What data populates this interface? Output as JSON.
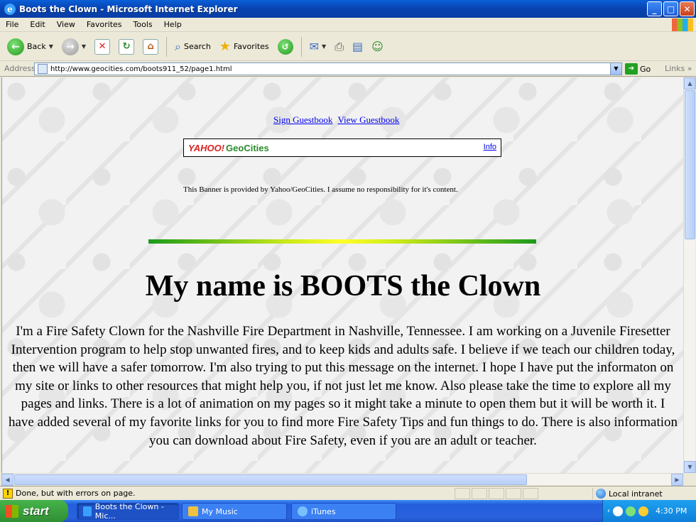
{
  "window": {
    "title": "Boots the Clown - Microsoft Internet Explorer"
  },
  "menu": [
    "File",
    "Edit",
    "View",
    "Favorites",
    "Tools",
    "Help"
  ],
  "toolbar": {
    "back_label": "Back",
    "search_label": "Search",
    "favorites_label": "Favorites"
  },
  "address": {
    "label": "Address",
    "url": "http://www.geocities.com/boots911_52/page1.html",
    "go_label": "Go",
    "links_label": "Links"
  },
  "page": {
    "sign_guestbook": "Sign Guestbook",
    "view_guestbook": "View Guestbook",
    "banner": {
      "logo_yahoo": "YAHOO!",
      "logo_geocities": "GeoCities",
      "info": "Info"
    },
    "disclaimer": "This Banner is provided by Yahoo/GeoCities. I assume no responsibility for it's content.",
    "headline": "My name is BOOTS the Clown",
    "body": "I'm a Fire Safety Clown for the Nashville Fire Department in Nashville, Tennessee. I am working on a Juvenile Firesetter Intervention program to help stop unwanted fires, and to keep kids and adults safe. I believe if we teach our children today, then we will have a safer tomorrow. I'm also trying to put this message on the internet. I hope I have put the informaton on my site or links to other resources that might help you, if not just let me know. Also please take the time to explore all my pages and links. There is a lot of animation on my pages so it might take a minute to open them but it will be worth it. I have added several of my favorite links for you to find more Fire Safety Tips and fun things to do. There is also information you can download about Fire Safety, even if you are an adult or teacher."
  },
  "status": {
    "text": "Done, but with errors on page.",
    "zone": "Local intranet"
  },
  "taskbar": {
    "start": "start",
    "tasks": [
      "Boots the Clown - Mic...",
      "My Music",
      "iTunes"
    ],
    "clock": "4:30 PM"
  },
  "colors": {
    "title_blue": "#0842b0",
    "link": "#0000ee",
    "start_green": "#2f8f33"
  }
}
